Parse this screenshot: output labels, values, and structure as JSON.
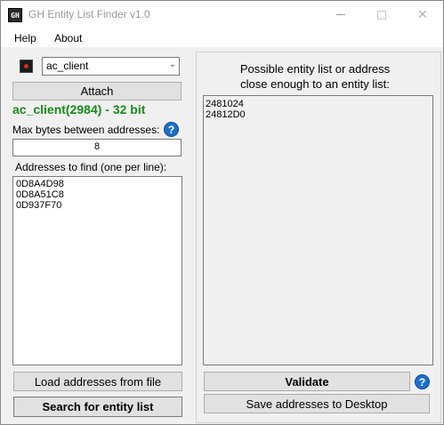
{
  "window": {
    "title": "GH Entity List Finder v1.0",
    "app_icon_text": "GH"
  },
  "menu": [
    "Help",
    "About"
  ],
  "left": {
    "process_selected": "ac_client",
    "attach_label": "Attach",
    "status": "ac_client(2984) - 32 bit",
    "max_bytes_label": "Max bytes between addresses:",
    "max_bytes_value": "8",
    "addresses_label": "Addresses to find (one per line):",
    "addresses": [
      "0D8A4D98",
      "0D8A51C8",
      "0D937F70"
    ],
    "load_label": "Load addresses from file",
    "search_label": "Search for entity list"
  },
  "right": {
    "heading_line1": "Possible entity list or address",
    "heading_line2": "close enough to an entity list:",
    "results": [
      "2481024",
      "24812D0"
    ],
    "validate_label": "Validate",
    "save_label": "Save addresses to Desktop"
  },
  "colors": {
    "status_green": "#1a8a1a",
    "help_blue": "#1e6fc9"
  },
  "icons": {
    "help": "?",
    "close": "✕"
  }
}
